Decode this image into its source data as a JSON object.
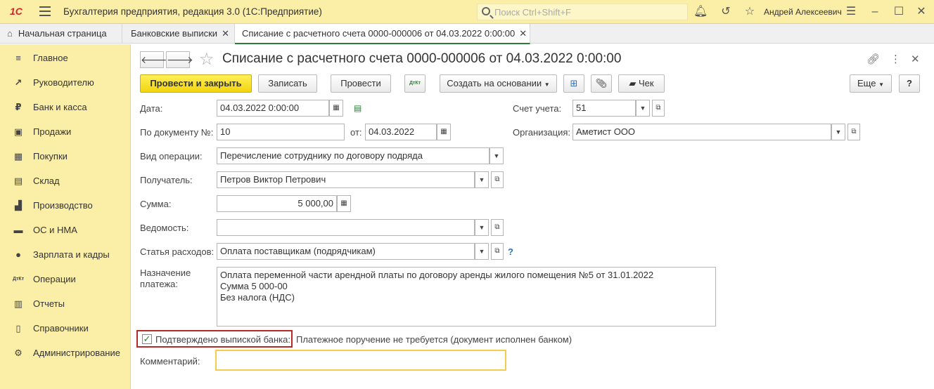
{
  "titlebar": {
    "logo": "1С",
    "app_title": "Бухгалтерия предприятия, редакция 3.0  (1С:Предприятие)",
    "search_placeholder": "Поиск Ctrl+Shift+F",
    "user": "Андрей Алексеевич"
  },
  "tabs": [
    {
      "label": "Начальная страница",
      "active": false
    },
    {
      "label": "Банковские выписки",
      "active": false,
      "close": "✕"
    },
    {
      "label": "Списание с расчетного счета 0000-000006 от 04.03.2022 0:00:00",
      "active": true,
      "close": "✕"
    }
  ],
  "sidebar": {
    "items": [
      {
        "label": "Главное",
        "icon": "≡"
      },
      {
        "label": "Руководителю",
        "icon": "↗"
      },
      {
        "label": "Банк и касса",
        "icon": "₽"
      },
      {
        "label": "Продажи",
        "icon": "▣"
      },
      {
        "label": "Покупки",
        "icon": "▦"
      },
      {
        "label": "Склад",
        "icon": "▤"
      },
      {
        "label": "Производство",
        "icon": "▟"
      },
      {
        "label": "ОС и НМА",
        "icon": "▬"
      },
      {
        "label": "Зарплата и кадры",
        "icon": "●"
      },
      {
        "label": "Операции",
        "icon": "ДтКт"
      },
      {
        "label": "Отчеты",
        "icon": "▥"
      },
      {
        "label": "Справочники",
        "icon": "▯"
      },
      {
        "label": "Администрирование",
        "icon": "⚙"
      }
    ]
  },
  "document": {
    "title": "Списание с расчетного счета 0000-000006 от 04.03.2022 0:00:00"
  },
  "toolbar": {
    "post_close": "Провести и закрыть",
    "save": "Записать",
    "post": "Провести",
    "dtkt": "ДтКт",
    "create_based": "Создать на основании",
    "check": "Чек",
    "more": "Еще",
    "help": "?"
  },
  "form": {
    "date_label": "Дата:",
    "date_value": "04.03.2022  0:00:00",
    "doc_no_label": "По документу №:",
    "doc_no_value": "10",
    "from_label": "от:",
    "from_value": "04.03.2022",
    "account_label": "Счет учета:",
    "account_value": "51",
    "org_label": "Организация:",
    "org_value": "Аметист ООО",
    "op_label": "Вид операции:",
    "op_value": "Перечисление сотруднику по договору подряда",
    "recipient_label": "Получатель:",
    "recipient_value": "Петров Виктор Петрович",
    "sum_label": "Сумма:",
    "sum_value": "5 000,00",
    "statement_label": "Ведомость:",
    "statement_value": "",
    "expense_label": "Статья расходов:",
    "expense_value": "Оплата поставщикам (подрядчикам)",
    "expense_help": "?",
    "purpose_label_1": "Назначение",
    "purpose_label_2": "платежа:",
    "purpose_lines": [
      "Оплата переменной части арендной платы по договору аренды жилого помещения №5 от 31.01.2022",
      "Сумма 5 000-00",
      "Без налога (НДС)"
    ],
    "confirmed_label": "Подтверждено выпиской банка:",
    "confirmed_checked": true,
    "order_note": "Платежное поручение не требуется (документ исполнен банком)",
    "comment_label": "Комментарий:",
    "comment_value": ""
  }
}
